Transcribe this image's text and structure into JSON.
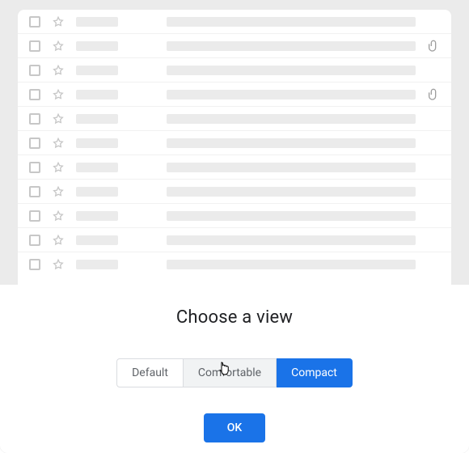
{
  "title": "Choose a view",
  "options": {
    "default": "Default",
    "comfortable": "Comfortable",
    "compact": "Compact"
  },
  "selected_option": "compact",
  "hovered_option": "comfortable",
  "ok_label": "OK",
  "rows": [
    {
      "has_attachment": false
    },
    {
      "has_attachment": true
    },
    {
      "has_attachment": false
    },
    {
      "has_attachment": true
    },
    {
      "has_attachment": false
    },
    {
      "has_attachment": false
    },
    {
      "has_attachment": false
    },
    {
      "has_attachment": false
    },
    {
      "has_attachment": false
    },
    {
      "has_attachment": false
    },
    {
      "has_attachment": false
    }
  ]
}
